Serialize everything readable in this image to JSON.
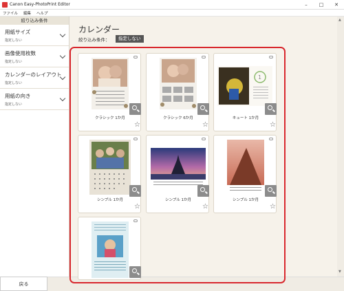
{
  "window": {
    "title": "Canon Easy-PhotoPrint Editor"
  },
  "menu": [
    "ファイル",
    "編集",
    "ヘルプ"
  ],
  "sidebar": {
    "header": "絞り込み条件",
    "filters": [
      {
        "title": "用紙サイズ",
        "value": "指定しない"
      },
      {
        "title": "画像使用枚数",
        "value": "指定しない"
      },
      {
        "title": "カレンダーのレイアウト",
        "value": "指定しない"
      },
      {
        "title": "用紙の向き",
        "value": "指定しない"
      }
    ],
    "back_label": "戻る"
  },
  "main": {
    "title": "カレンダー",
    "condition_label": "絞り込み条件：",
    "condition_value": "指定しない"
  },
  "templates": [
    {
      "label": "クラシック 1か月",
      "favorite": false
    },
    {
      "label": "クラシック 6か月",
      "favorite": false
    },
    {
      "label": "キュート 1か月",
      "favorite": false
    },
    {
      "label": "シンプル 1か月",
      "favorite": false
    },
    {
      "label": "シンプル 1か月",
      "favorite": false
    },
    {
      "label": "シンプル 1か月",
      "favorite": false
    },
    {
      "label": "",
      "favorite": false
    }
  ],
  "colors": {
    "accent_frame": "#d8272d",
    "sidebar_header": "#e9e4d8",
    "badge": "#555555"
  }
}
